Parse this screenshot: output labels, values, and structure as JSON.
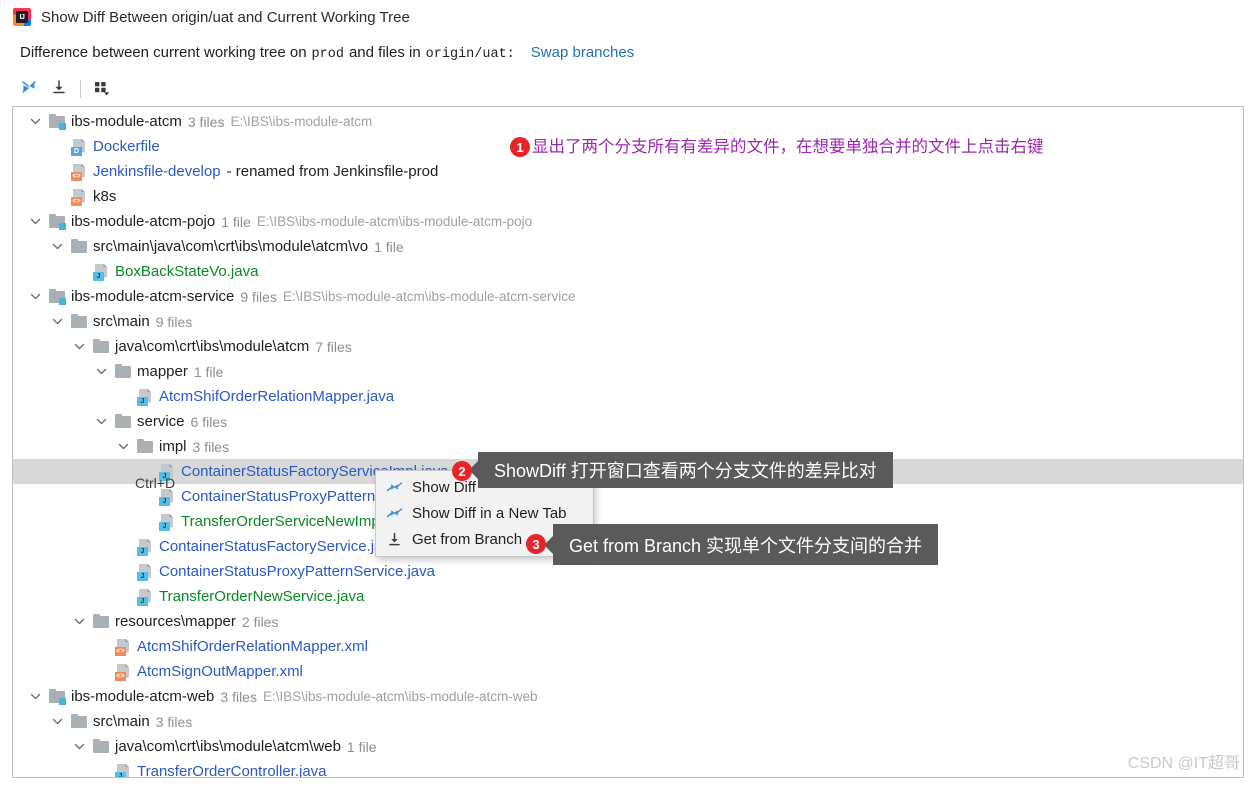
{
  "window": {
    "title": "Show Diff Between origin/uat and Current Working Tree",
    "logo_label": "IJ",
    "logo_icon": "intellij-idea-icon"
  },
  "description": {
    "text_before_branch": "Difference between current working tree on",
    "current_branch": "prod",
    "text_middle": "and files in",
    "target_branch": "origin/uat:",
    "swap_link": "Swap branches"
  },
  "toolbar": {
    "buttons": [
      {
        "name": "collapse-all-button",
        "icon": "collapse-arrows-icon"
      },
      {
        "name": "get-from-branch-button",
        "icon": "download-arrow-icon"
      },
      {
        "name": "group-by-button",
        "icon": "group-by-icon"
      }
    ]
  },
  "tree": {
    "rows": [
      {
        "indent": 0,
        "chevron": "down",
        "icon": "module-folder-icon",
        "label": "ibs-module-atcm",
        "label_color": "dark",
        "count": "3 files",
        "path": "E:\\IBS\\ibs-module-atcm"
      },
      {
        "indent": 1,
        "chevron": "none",
        "icon": "docker-file-icon",
        "badge": "D",
        "badge_class": "badge-docker",
        "label": "Dockerfile",
        "label_color": "blue"
      },
      {
        "indent": 1,
        "chevron": "none",
        "icon": "xml-file-icon",
        "badge": "<>",
        "badge_class": "badge-xml",
        "label": "Jenkinsfile-develop",
        "label_color": "blue",
        "note": "- renamed from Jenkinsfile-prod"
      },
      {
        "indent": 1,
        "chevron": "none",
        "icon": "xml-file-icon",
        "badge": "<>",
        "badge_class": "badge-xml",
        "label": "k8s",
        "label_color": "dark"
      },
      {
        "indent": 0,
        "chevron": "down",
        "icon": "module-folder-icon",
        "label": "ibs-module-atcm-pojo",
        "label_color": "dark",
        "count": "1 file",
        "path": "E:\\IBS\\ibs-module-atcm\\ibs-module-atcm-pojo"
      },
      {
        "indent": 1,
        "chevron": "down",
        "icon": "folder-icon",
        "label": "src\\main\\java\\com\\crt\\ibs\\module\\atcm\\vo",
        "label_color": "dark",
        "count": "1 file"
      },
      {
        "indent": 2,
        "chevron": "none",
        "icon": "java-file-icon",
        "badge": "J",
        "badge_class": "badge-java",
        "label": "BoxBackStateVo.java",
        "label_color": "green"
      },
      {
        "indent": 0,
        "chevron": "down",
        "icon": "module-folder-icon",
        "label": "ibs-module-atcm-service",
        "label_color": "dark",
        "count": "9 files",
        "path": "E:\\IBS\\ibs-module-atcm\\ibs-module-atcm-service"
      },
      {
        "indent": 1,
        "chevron": "down",
        "icon": "folder-icon",
        "label": "src\\main",
        "label_color": "dark",
        "count": "9 files"
      },
      {
        "indent": 2,
        "chevron": "down",
        "icon": "folder-icon",
        "label": "java\\com\\crt\\ibs\\module\\atcm",
        "label_color": "dark",
        "count": "7 files"
      },
      {
        "indent": 3,
        "chevron": "down",
        "icon": "folder-icon",
        "label": "mapper",
        "label_color": "dark",
        "count": "1 file"
      },
      {
        "indent": 4,
        "chevron": "none",
        "icon": "java-file-icon",
        "badge": "J",
        "badge_class": "badge-java",
        "label": "AtcmShifOrderRelationMapper.java",
        "label_color": "blue"
      },
      {
        "indent": 3,
        "chevron": "down",
        "icon": "folder-icon",
        "label": "service",
        "label_color": "dark",
        "count": "6 files"
      },
      {
        "indent": 4,
        "chevron": "down",
        "icon": "folder-icon",
        "label": "impl",
        "label_color": "dark",
        "count": "3 files"
      },
      {
        "indent": 5,
        "chevron": "none",
        "icon": "java-file-icon",
        "badge": "J",
        "badge_class": "badge-java",
        "label": "ContainerStatusFactoryServiceImpl.java",
        "label_color": "blue",
        "selected": true
      },
      {
        "indent": 5,
        "chevron": "none",
        "icon": "java-file-icon",
        "badge": "J",
        "badge_class": "badge-java",
        "label": "ContainerStatusProxyPatternServiceImpl.java",
        "label_color": "blue"
      },
      {
        "indent": 5,
        "chevron": "none",
        "icon": "java-file-icon",
        "badge": "J",
        "badge_class": "badge-java",
        "label": "TransferOrderServiceNewImpl.java",
        "label_color": "green"
      },
      {
        "indent": 4,
        "chevron": "none",
        "icon": "java-file-icon",
        "badge": "J",
        "badge_class": "badge-java",
        "label": "ContainerStatusFactoryService.java",
        "label_color": "blue"
      },
      {
        "indent": 4,
        "chevron": "none",
        "icon": "java-file-icon",
        "badge": "J",
        "badge_class": "badge-java",
        "label": "ContainerStatusProxyPatternService.java",
        "label_color": "blue"
      },
      {
        "indent": 4,
        "chevron": "none",
        "icon": "java-file-icon",
        "badge": "J",
        "badge_class": "badge-java",
        "label": "TransferOrderNewService.java",
        "label_color": "green"
      },
      {
        "indent": 2,
        "chevron": "down",
        "icon": "folder-icon",
        "label": "resources\\mapper",
        "label_color": "dark",
        "count": "2 files"
      },
      {
        "indent": 3,
        "chevron": "none",
        "icon": "xml-file-icon",
        "badge": "<>",
        "badge_class": "badge-xml",
        "label": "AtcmShifOrderRelationMapper.xml",
        "label_color": "blue"
      },
      {
        "indent": 3,
        "chevron": "none",
        "icon": "xml-file-icon",
        "badge": "<>",
        "badge_class": "badge-xml",
        "label": "AtcmSignOutMapper.xml",
        "label_color": "blue"
      },
      {
        "indent": 0,
        "chevron": "down",
        "icon": "module-folder-icon",
        "label": "ibs-module-atcm-web",
        "label_color": "dark",
        "count": "3 files",
        "path": "E:\\IBS\\ibs-module-atcm\\ibs-module-atcm-web"
      },
      {
        "indent": 1,
        "chevron": "down",
        "icon": "folder-icon",
        "label": "src\\main",
        "label_color": "dark",
        "count": "3 files"
      },
      {
        "indent": 2,
        "chevron": "down",
        "icon": "folder-icon",
        "label": "java\\com\\crt\\ibs\\module\\atcm\\web",
        "label_color": "dark",
        "count": "1 file"
      },
      {
        "indent": 3,
        "chevron": "none",
        "icon": "java-file-icon",
        "badge": "J",
        "badge_class": "badge-java",
        "label": "TransferOrderController.java",
        "label_color": "blue"
      }
    ]
  },
  "context_menu": {
    "items": [
      {
        "label": "Show Diff",
        "icon": "show-diff-icon",
        "shortcut": "Ctrl+D"
      },
      {
        "label": "Show Diff in a New Tab",
        "icon": "show-diff-icon",
        "shortcut": ""
      },
      {
        "label": "Get from Branch",
        "icon": "download-arrow-icon",
        "shortcut": ""
      }
    ],
    "shortcut_display": "Ctrl+D"
  },
  "annotations": {
    "badge1": "1",
    "badge2": "2",
    "badge3": "3",
    "note1": "显出了两个分支所有有差异的文件，在想要单独合并的文件上点击右键",
    "callout2": "ShowDiff 打开窗口查看两个分支文件的差异比对",
    "callout3": "Get from Branch 实现单个文件分支间的合并"
  },
  "watermark": "CSDN @IT超哥",
  "colors": {
    "link": "#2470b3",
    "file_blue": "#2b59c3",
    "file_green": "#0a8a24",
    "annotation_purple": "#9c27b0",
    "badge_red": "#e8232a",
    "callout_bg": "#5a5a5a",
    "selection": "#d8d8d8"
  }
}
